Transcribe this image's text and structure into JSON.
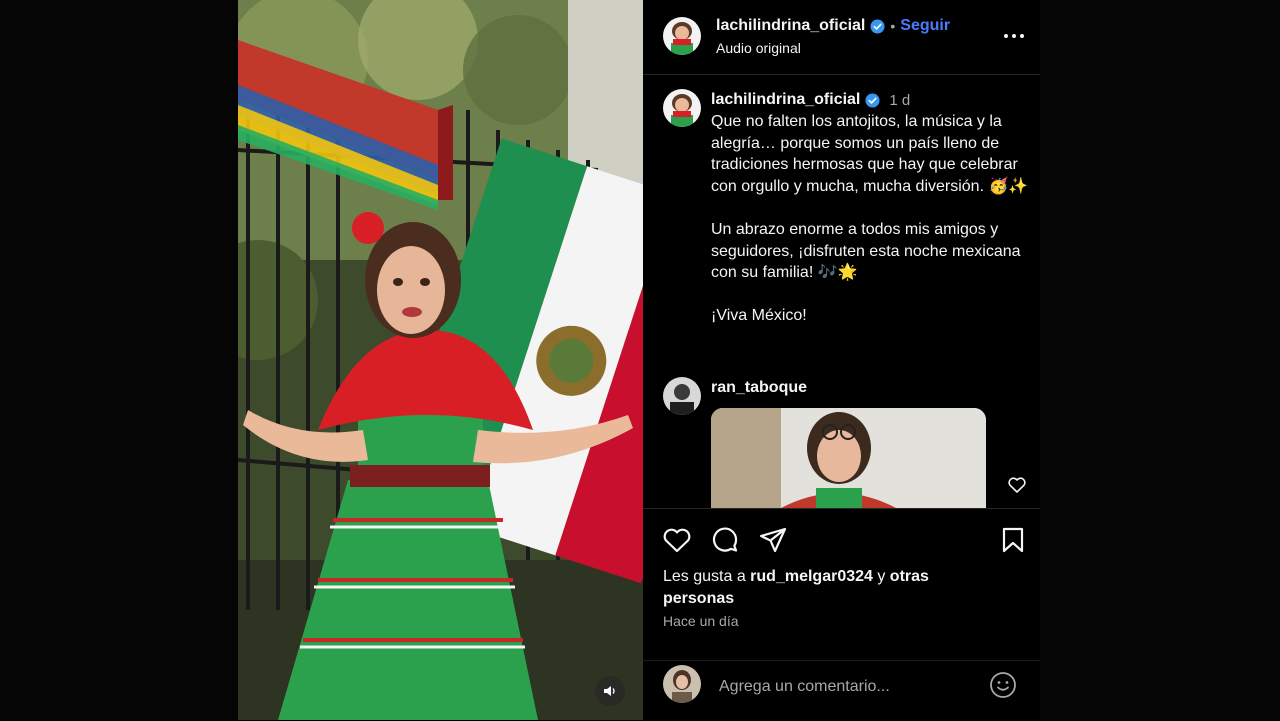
{
  "post": {
    "username": "lachilindrina_oficial",
    "follow_label": "Seguir",
    "dot": "•",
    "audio_label": "Audio original"
  },
  "caption": {
    "username": "lachilindrina_oficial",
    "time": "1 d",
    "paragraph1": "Que no falten los antojitos, la música y la alegría… porque somos un país lleno de tradiciones hermosas que hay que celebrar con orgullo y mucha, mucha diversión. 🥳✨",
    "paragraph2": "Un abrazo enorme a todos mis amigos y seguidores, ¡disfruten esta noche mexicana con su familia! 🎶🌟",
    "paragraph3": "¡Viva México!"
  },
  "comment": {
    "username": "ran_taboque"
  },
  "likes": {
    "prefix": "Les gusta a ",
    "user": "rud_melgar0324",
    "middle": " y ",
    "rest": "otras personas"
  },
  "time_ago": "Hace un día",
  "add_comment": {
    "placeholder": "Agrega un comentario..."
  },
  "icons": {
    "verified": "verified-badge-icon",
    "more": "more-options-icon",
    "like": "heart-icon",
    "comment": "comment-icon",
    "share": "share-icon",
    "save": "bookmark-icon",
    "emoji": "emoji-icon",
    "mute": "speaker-icon"
  },
  "colors": {
    "follow": "#4a7bff",
    "verified": "#3897f0",
    "muted_text": "#a8a8a8"
  }
}
